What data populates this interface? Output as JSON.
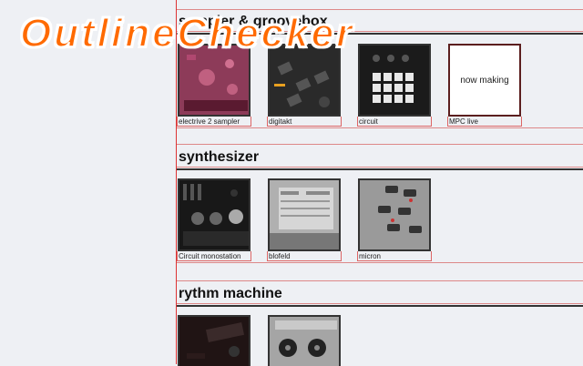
{
  "brand": {
    "title": "OutlineChecker"
  },
  "sections": [
    {
      "title": "sampler & groovebox",
      "items": [
        {
          "caption": "electrive 2 sampler",
          "icon": "electribe-sampler-photo"
        },
        {
          "caption": "digitakt",
          "icon": "digitakt-photo"
        },
        {
          "caption": "circuit",
          "icon": "circuit-photo"
        },
        {
          "caption": "MPC live",
          "placeholder": "now making"
        }
      ]
    },
    {
      "title": "synthesizer",
      "items": [
        {
          "caption": "Circuit monostation",
          "icon": "circuit-monostation-photo"
        },
        {
          "caption": "blofeld",
          "icon": "blofeld-photo"
        },
        {
          "caption": "micron",
          "icon": "micron-photo"
        }
      ]
    },
    {
      "title": "rythm machine",
      "items": [
        {
          "caption": "",
          "icon": "rhythm-machine-1-photo"
        },
        {
          "caption": "",
          "icon": "rhythm-machine-2-photo"
        }
      ]
    }
  ],
  "colors": {
    "brand": "#ff6a00",
    "outline": "#dd3333"
  }
}
